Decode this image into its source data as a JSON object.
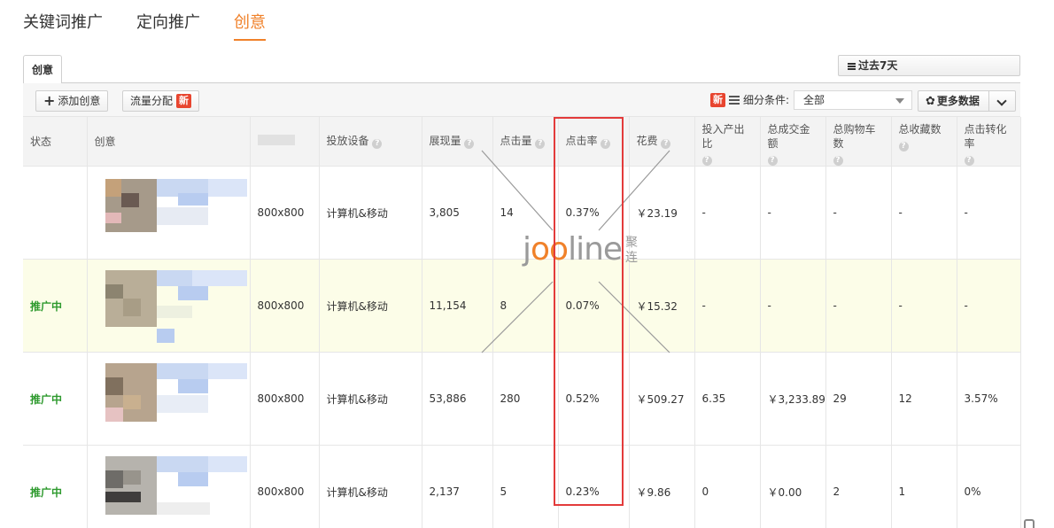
{
  "top_tabs": [
    "关键词推广",
    "定向推广",
    "创意"
  ],
  "sub_tab": "创意",
  "date_range": "过去7天",
  "toolbar": {
    "add_label": "添加创意",
    "flow_label": "流量分配",
    "new_badge": "新",
    "filter_label": "细分条件:",
    "filter_value": "全部",
    "more_label": "更多数据"
  },
  "columns": {
    "status": "状态",
    "creative": "创意",
    "device": "投放设备",
    "impressions": "展现量",
    "clicks": "点击量",
    "ctr": "点击率",
    "cost": "花费",
    "roi": "投入产出比",
    "gmv": "总成交金额",
    "cart": "总购物车数",
    "fav": "总收藏数",
    "cvr": "点击转化率"
  },
  "rows": [
    {
      "status": "",
      "size": "800x800",
      "device": "计算机&移动",
      "impressions": "3,805",
      "clicks": "14",
      "ctr": "0.37%",
      "cost": "￥23.19",
      "roi": "-",
      "gmv": "-",
      "cart": "-",
      "fav": "-",
      "cvr": "-"
    },
    {
      "status": "推广中",
      "size": "800x800",
      "device": "计算机&移动",
      "impressions": "11,154",
      "clicks": "8",
      "ctr": "0.07%",
      "cost": "￥15.32",
      "roi": "-",
      "gmv": "-",
      "cart": "-",
      "fav": "-",
      "cvr": "-"
    },
    {
      "status": "推广中",
      "size": "800x800",
      "device": "计算机&移动",
      "impressions": "53,886",
      "clicks": "280",
      "ctr": "0.52%",
      "cost": "￥509.27",
      "roi": "6.35",
      "gmv": "￥3,233.89",
      "cart": "29",
      "fav": "12",
      "cvr": "3.57%"
    },
    {
      "status": "推广中",
      "size": "800x800",
      "device": "计算机&移动",
      "impressions": "2,137",
      "clicks": "5",
      "ctr": "0.23%",
      "cost": "￥9.86",
      "roi": "0",
      "gmv": "￥0.00",
      "cart": "2",
      "fav": "1",
      "cvr": "0%"
    }
  ],
  "watermark": {
    "brand_a": "j",
    "brand_oo": "oo",
    "brand_b": "line",
    "brand_cn": "聚连"
  },
  "colors": {
    "accent": "#f0812a",
    "status_green": "#2e9a2e",
    "highlight_row": "#fcfde8",
    "annotation_red": "#e33b3b",
    "new_badge": "#e8452f"
  }
}
